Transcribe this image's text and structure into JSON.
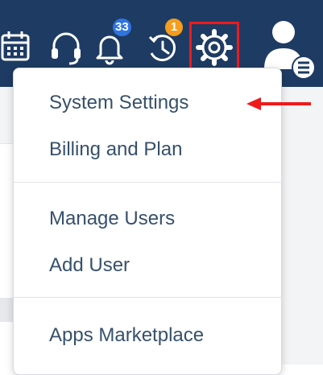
{
  "header": {
    "icons": {
      "calendar": "calendar-icon",
      "support": "headset-icon",
      "notifications": "bell-icon",
      "recent": "history-icon",
      "settings": "gear-icon",
      "user": "user-avatar-icon"
    },
    "notifications_badge": "33",
    "recent_badge": "1",
    "colors": {
      "bar": "#1e3b63",
      "icon": "#ffffff",
      "badge_notifications": "#2f74df",
      "badge_recent": "#f59d1c",
      "highlight": "#ef1a1a"
    }
  },
  "settings_menu": {
    "items": [
      {
        "label": "System Settings"
      },
      {
        "label": "Billing and Plan"
      },
      {
        "label": "Manage Users"
      },
      {
        "label": "Add User"
      },
      {
        "label": "Apps Marketplace"
      }
    ],
    "text_color": "#36506b"
  },
  "annotation": {
    "arrow_icon": "left-arrow-icon",
    "color": "#ef1a1a"
  }
}
